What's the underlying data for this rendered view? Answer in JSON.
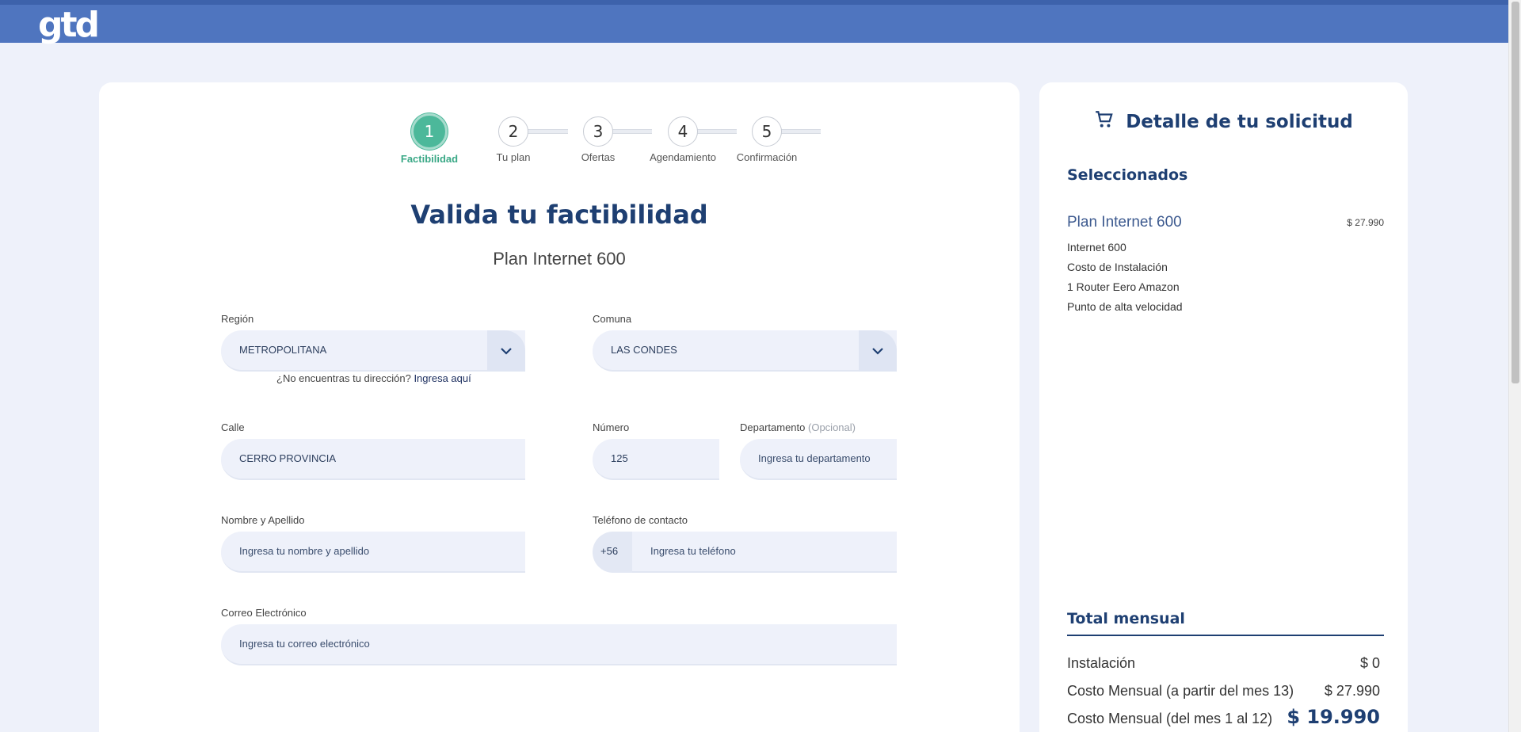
{
  "header": {
    "logo": "gtd"
  },
  "stepper": {
    "steps": [
      {
        "number": "1",
        "label": "Factibilidad",
        "active": true
      },
      {
        "number": "2",
        "label": "Tu plan",
        "active": false
      },
      {
        "number": "3",
        "label": "Ofertas",
        "active": false
      },
      {
        "number": "4",
        "label": "Agendamiento",
        "active": false
      },
      {
        "number": "5",
        "label": "Confirmación",
        "active": false
      }
    ]
  },
  "form": {
    "title": "Valida tu factibilidad",
    "subtitle": "Plan Internet 600",
    "region": {
      "label": "Región",
      "value": "METROPOLITANA"
    },
    "comuna": {
      "label": "Comuna",
      "value": "LAS CONDES"
    },
    "helper_text": "¿No encuentras tu dirección?",
    "helper_link": "Ingresa aquí",
    "calle": {
      "label": "Calle",
      "value": "CERRO PROVINCIA"
    },
    "numero": {
      "label": "Número",
      "value": "125"
    },
    "departamento": {
      "label": "Departamento",
      "optional": "(Opcional)",
      "placeholder": "Ingresa tu departamento"
    },
    "nombre": {
      "label": "Nombre y Apellido",
      "placeholder": "Ingresa tu nombre y apellido"
    },
    "telefono": {
      "label": "Teléfono de contacto",
      "prefix": "+56",
      "placeholder": "Ingresa tu teléfono"
    },
    "correo": {
      "label": "Correo Electrónico",
      "placeholder": "Ingresa tu correo electrónico"
    }
  },
  "summary": {
    "title": "Detalle de tu solicitud",
    "icon": "cart-icon",
    "section": "Seleccionados",
    "plan_name": "Plan Internet 600",
    "plan_price": "$ 27.990",
    "items": [
      "Internet 600",
      "Costo de Instalación",
      "1 Router Eero Amazon",
      "Punto de alta velocidad"
    ],
    "total_title": "Total mensual",
    "rows": [
      {
        "label": "Instalación",
        "value": "$ 0"
      },
      {
        "label": "Costo Mensual (a partir del mes 13)",
        "value": "$ 27.990"
      },
      {
        "label": "Costo Mensual (del mes 1 al 12)",
        "value": "$ 19.990"
      }
    ]
  },
  "colors": {
    "header": "#4f75bf",
    "accent_green": "#4cb89a",
    "brand_navy": "#1e3f72",
    "input_bg": "#eef1fa"
  }
}
